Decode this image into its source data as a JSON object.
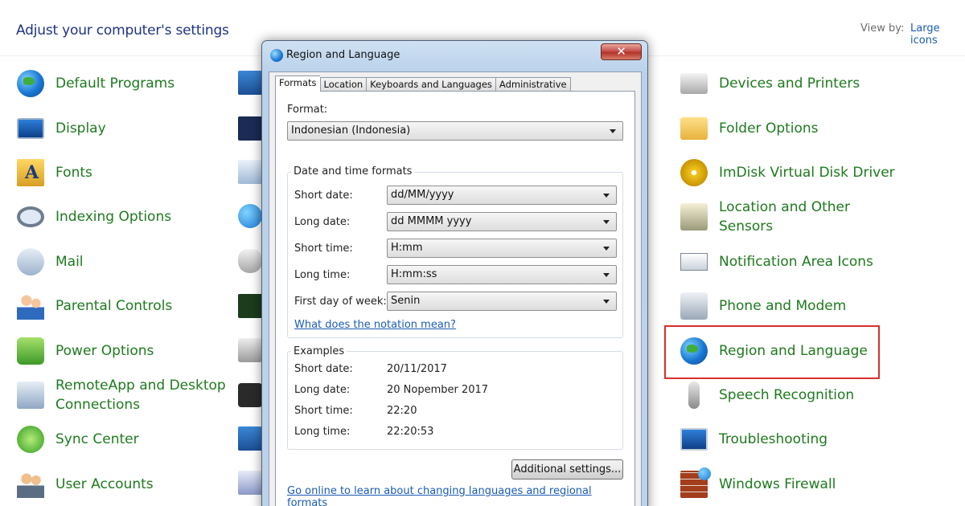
{
  "control_panel": {
    "title": "Adjust your computer's settings",
    "view_by_label": "View by:",
    "view_by_value": "Large icons",
    "left_items": [
      {
        "label": "Default Programs",
        "icon": "default-programs-icon"
      },
      {
        "label": "Display",
        "icon": "display-icon"
      },
      {
        "label": "Fonts",
        "icon": "fonts-icon"
      },
      {
        "label": "Indexing Options",
        "icon": "indexing-icon"
      },
      {
        "label": "Mail",
        "icon": "mail-icon"
      },
      {
        "label": "Parental Controls",
        "icon": "parental-controls-icon"
      },
      {
        "label": "Power Options",
        "icon": "power-options-icon"
      },
      {
        "label": "RemoteApp and Desktop",
        "label2": "Connections",
        "icon": "remoteapp-icon"
      },
      {
        "label": "Sync Center",
        "icon": "sync-center-icon"
      },
      {
        "label": "User Accounts",
        "icon": "user-accounts-icon"
      }
    ],
    "right_items": [
      {
        "label": "Devices and Printers",
        "icon": "printer-icon"
      },
      {
        "label": "Folder Options",
        "icon": "folder-icon"
      },
      {
        "label": "ImDisk Virtual Disk Driver",
        "icon": "disk-icon"
      },
      {
        "label": "Location and Other",
        "label2": "Sensors",
        "icon": "sensor-icon"
      },
      {
        "label": "Notification Area Icons",
        "icon": "notification-icon"
      },
      {
        "label": "Phone and Modem",
        "icon": "phone-icon"
      },
      {
        "label": "Region and Language",
        "icon": "globe-clock-icon"
      },
      {
        "label": "Speech Recognition",
        "icon": "microphone-icon"
      },
      {
        "label": "Troubleshooting",
        "icon": "troubleshooting-icon"
      },
      {
        "label": "Windows Firewall",
        "icon": "firewall-icon"
      }
    ]
  },
  "dialog": {
    "title": "Region and Language",
    "close_glyph": "✕",
    "tabs": [
      "Formats",
      "Location",
      "Keyboards and Languages",
      "Administrative"
    ],
    "active_tab": "Formats",
    "format_label": "Format:",
    "format_value": "Indonesian (Indonesia)",
    "date_time_group_title": "Date and time formats",
    "date_time_rows": [
      {
        "label": "Short date:",
        "value": "dd/MM/yyyy"
      },
      {
        "label": "Long date:",
        "value": "dd MMMM yyyy"
      },
      {
        "label": "Short time:",
        "value": "H:mm"
      },
      {
        "label": "Long time:",
        "value": "H:mm:ss"
      },
      {
        "label": "First day of week:",
        "value": "Senin"
      }
    ],
    "notation_link": "What does the notation mean?",
    "examples_group_title": "Examples",
    "examples": [
      {
        "label": "Short date:",
        "value": "20/11/2017"
      },
      {
        "label": "Long date:",
        "value": "20 Nopember 2017"
      },
      {
        "label": "Short time:",
        "value": "22:20"
      },
      {
        "label": "Long time:",
        "value": "22:20:53"
      }
    ],
    "additional_settings_button": "Additional settings...",
    "online_link": "Go online to learn about changing languages and regional formats"
  },
  "colors": {
    "item_text": "#1e7a1e",
    "title_text": "#1e3287",
    "link": "#1a5bb5",
    "highlight": "#d9302c"
  }
}
